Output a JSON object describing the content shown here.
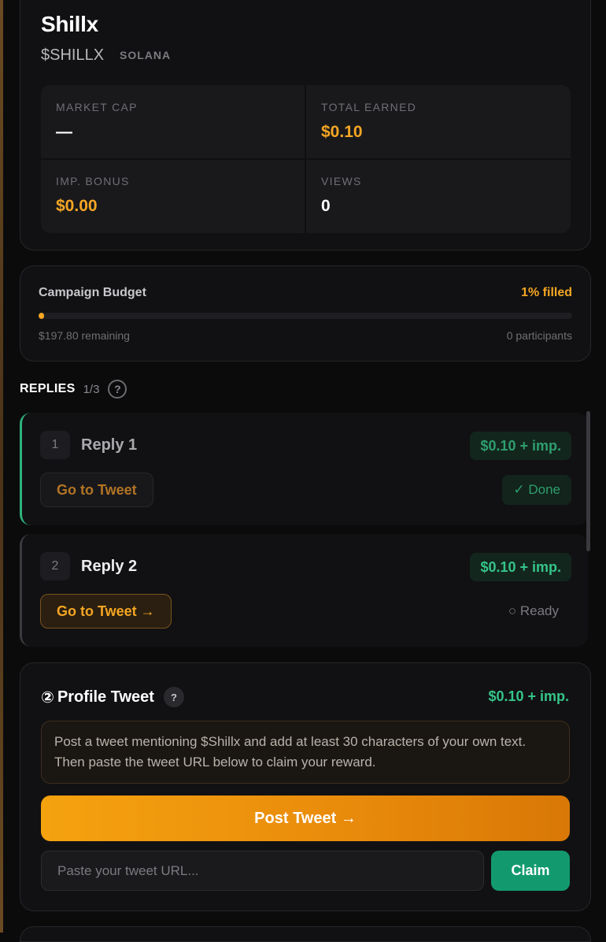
{
  "token": {
    "name": "Shillx",
    "ticker": "$SHILLX",
    "chain": "SOLANA"
  },
  "stats": {
    "market_cap": {
      "label": "MARKET CAP",
      "value": "—"
    },
    "total_earned": {
      "label": "TOTAL EARNED",
      "value": "$0.10"
    },
    "imp_bonus": {
      "label": "IMP. BONUS",
      "value": "$0.00"
    },
    "views": {
      "label": "VIEWS",
      "value": "0"
    }
  },
  "budget": {
    "title": "Campaign Budget",
    "filled_label": "1% filled",
    "filled_percent": 1,
    "remaining": "$197.80 remaining",
    "participants": "0 participants"
  },
  "replies": {
    "title": "REPLIES",
    "count": "1/3",
    "help": "?",
    "items": [
      {
        "number": "1",
        "title": "Reply 1",
        "reward": "$0.10 + imp.",
        "button": "Go to Tweet",
        "status": "✓ Done"
      },
      {
        "number": "2",
        "title": "Reply 2",
        "reward": "$0.10 + imp.",
        "button": "Go to Tweet →",
        "status": "○ Ready"
      }
    ]
  },
  "profile_tweet": {
    "step": "②",
    "title": "Profile Tweet",
    "help": "?",
    "reward": "$0.10 + imp.",
    "instructions_line1": "Post a tweet mentioning $Shillx and add at least 30 characters of your own text.",
    "instructions_line2": "Then paste the tweet URL below to claim your reward.",
    "post_button": "Post Tweet →",
    "url_placeholder": "Paste your tweet URL...",
    "url_value": "",
    "claim_button": "Claim"
  },
  "colors": {
    "accent_gold": "#f5a623",
    "accent_green": "#35c489",
    "claim_green": "#129a6e"
  }
}
